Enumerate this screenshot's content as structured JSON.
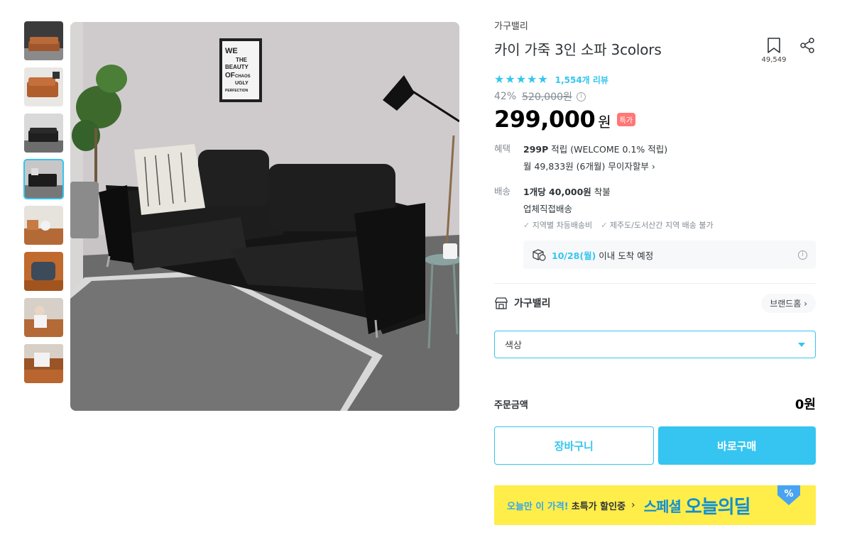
{
  "thumbnails": [
    {
      "name": "thumb-brown-sofa-room",
      "active": false
    },
    {
      "name": "thumb-brown-sofa-front",
      "active": false
    },
    {
      "name": "thumb-black-sofa-wall",
      "active": false
    },
    {
      "name": "thumb-black-sofa-angle",
      "active": true
    },
    {
      "name": "thumb-sofa-with-dog",
      "active": false
    },
    {
      "name": "thumb-sofa-cushion-detail",
      "active": false
    },
    {
      "name": "thumb-person-on-sofa",
      "active": false
    },
    {
      "name": "thumb-leather-detail",
      "active": false
    }
  ],
  "main_image": {
    "poster_lines": [
      "WE",
      "THE",
      "BEAUTY",
      "OF",
      "CHAOS",
      "UGLY",
      "PERFECTION"
    ]
  },
  "product": {
    "brand": "가구밸리",
    "title": "카이 가죽 3인 소파 3colors",
    "bookmark_count": "49,549",
    "rating_stars": 5,
    "review_count": "1,554개 리뷰",
    "discount_rate": "42%",
    "original_price": "520,000원",
    "price": "299,000",
    "currency": "원",
    "special_badge": "특가"
  },
  "benefit": {
    "label": "혜택",
    "points": "299P",
    "points_text": " 적립 (WELCOME 0.1% 적립)",
    "installment": "월 49,833원 (6개월) 무이자할부 ›"
  },
  "shipping": {
    "label": "배송",
    "fee_bold": "1개당 40,000원",
    "fee_text": " 착불",
    "method": "업체직접배송",
    "notes": [
      "지역별 차등배송비",
      "제주도/도서산간 지역 배송 불가"
    ],
    "arrival_date": "10/28(월)",
    "arrival_text": "이내 도착 예정"
  },
  "brand_row": {
    "name": "가구밸리",
    "home_button": "브랜드홈 ›"
  },
  "option": {
    "placeholder": "색상"
  },
  "order": {
    "label": "주문금액",
    "amount": "0원"
  },
  "buttons": {
    "cart": "장바구니",
    "buy": "바로구매"
  },
  "deal_banner": {
    "promo_blue": "오늘만 이 가격!",
    "promo_dark": "초특가 할인중",
    "chevron": "›",
    "special": "스페셜",
    "oneul": "오늘의딜",
    "tag": "%"
  },
  "colors": {
    "accent": "#35c5f0",
    "badge": "#ff7777",
    "banner": "#ffed4a",
    "banner_text": "#0f8ed4"
  }
}
